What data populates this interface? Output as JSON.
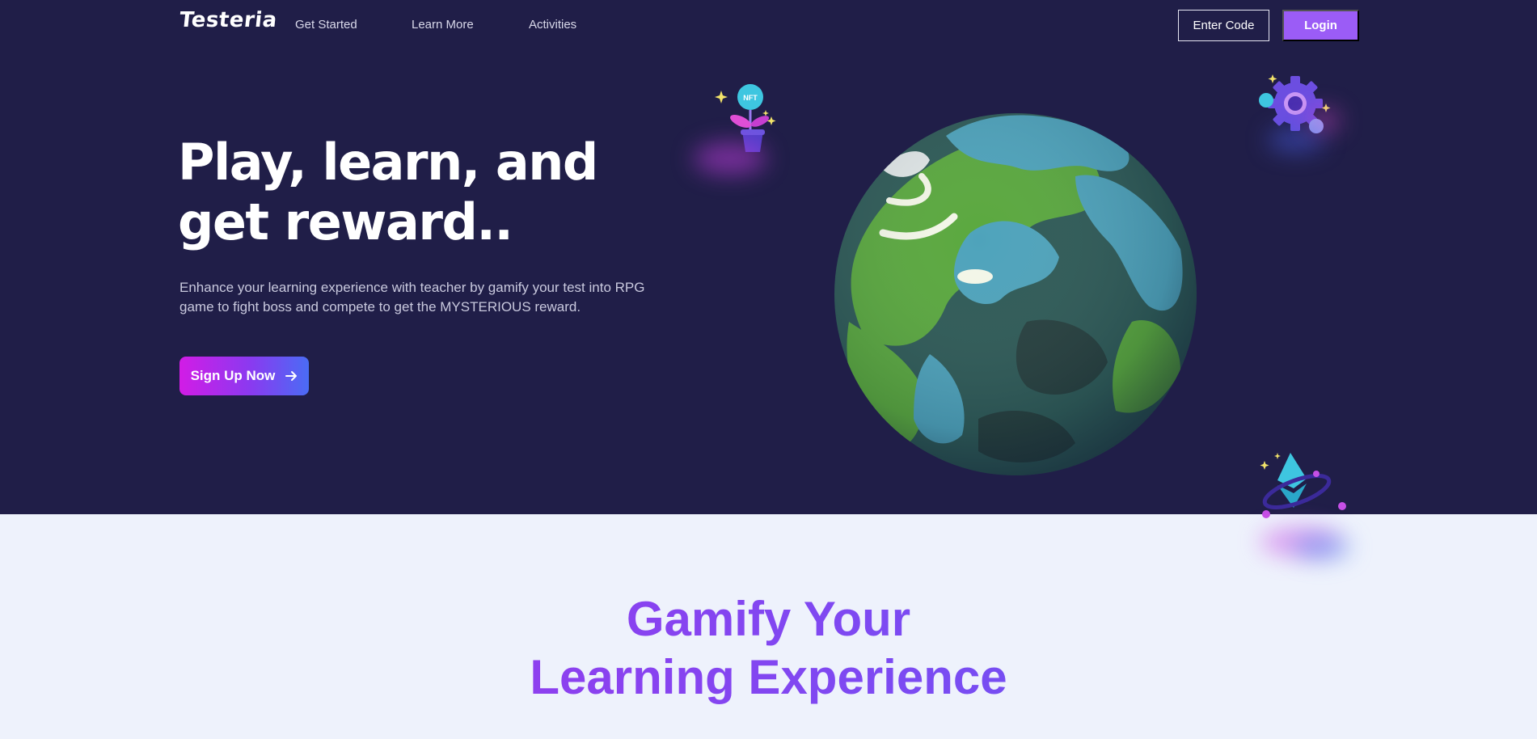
{
  "nav": {
    "logo": "Testeria",
    "links": [
      "Get Started",
      "Learn More",
      "Activities"
    ],
    "enter_code_label": "Enter Code",
    "login_label": "Login"
  },
  "hero": {
    "headline": "Play, learn, and get reward..",
    "description": "Enhance your learning experience with teacher by gamify your test into RPG game to fight boss and compete to get the MYSTERIOUS reward.",
    "signup_label": "Sign Up Now",
    "signup_icon": "arrow-right-icon",
    "nft_badge": "NFT"
  },
  "section2": {
    "title_line1": "Gamify Your",
    "title_line2": "Learning Experience"
  },
  "colors": {
    "hero_bg": "#201e48",
    "page_bg": "#eef2fc",
    "accent_purple": "#9b5cf6",
    "gradient_start": "#d21ce6",
    "gradient_end": "#4a6cf5"
  }
}
